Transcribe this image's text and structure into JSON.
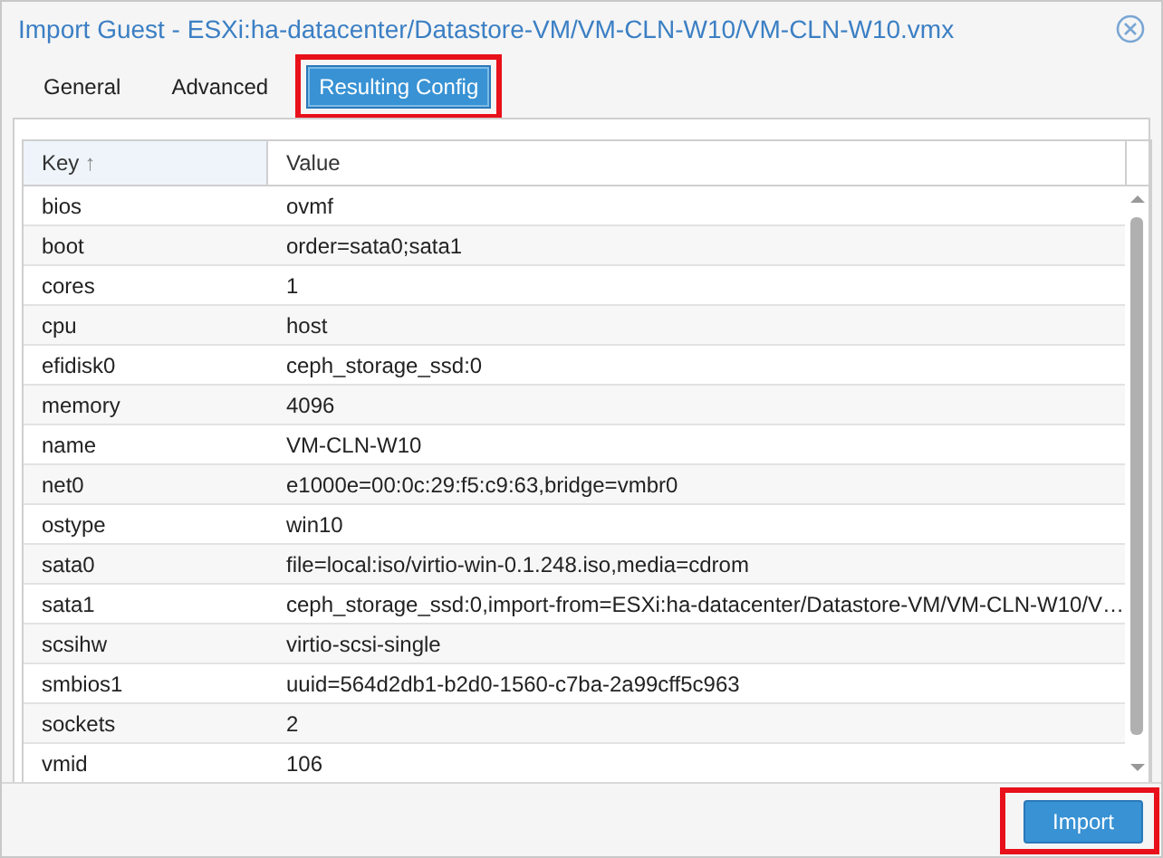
{
  "window": {
    "title": "Import Guest - ESXi:ha-datacenter/Datastore-VM/VM-CLN-W10/VM-CLN-W10.vmx"
  },
  "tabs": [
    {
      "label": "General",
      "selected": false,
      "highlighted": false
    },
    {
      "label": "Advanced",
      "selected": false,
      "highlighted": false
    },
    {
      "label": "Resulting Config",
      "selected": true,
      "highlighted": true
    }
  ],
  "table": {
    "columns": [
      {
        "label": "Key",
        "sort_indicator": "↑"
      },
      {
        "label": "Value"
      }
    ],
    "rows": [
      {
        "key": "bios",
        "value": "ovmf"
      },
      {
        "key": "boot",
        "value": "order=sata0;sata1"
      },
      {
        "key": "cores",
        "value": "1"
      },
      {
        "key": "cpu",
        "value": "host"
      },
      {
        "key": "efidisk0",
        "value": "ceph_storage_ssd:0"
      },
      {
        "key": "memory",
        "value": "4096"
      },
      {
        "key": "name",
        "value": "VM-CLN-W10"
      },
      {
        "key": "net0",
        "value": "e1000e=00:0c:29:f5:c9:63,bridge=vmbr0"
      },
      {
        "key": "ostype",
        "value": "win10"
      },
      {
        "key": "sata0",
        "value": "file=local:iso/virtio-win-0.1.248.iso,media=cdrom"
      },
      {
        "key": "sata1",
        "value": "ceph_storage_ssd:0,import-from=ESXi:ha-datacenter/Datastore-VM/VM-CLN-W10/V…"
      },
      {
        "key": "scsihw",
        "value": "virtio-scsi-single"
      },
      {
        "key": "smbios1",
        "value": "uuid=564d2db1-b2d0-1560-c7ba-2a99cff5c963"
      },
      {
        "key": "sockets",
        "value": "2"
      },
      {
        "key": "vmid",
        "value": "106"
      }
    ]
  },
  "buttons": [
    {
      "label": "Import",
      "highlighted": true
    }
  ]
}
